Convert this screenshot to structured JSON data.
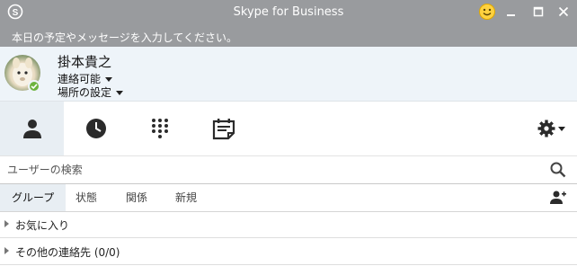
{
  "window": {
    "title": "Skype for Business",
    "icons": {
      "app": "skype-logo-icon",
      "emoji": "smiley-icon",
      "minimize": "minimize-icon",
      "maximize": "maximize-icon",
      "close": "close-icon"
    }
  },
  "note": {
    "placeholder": "本日の予定やメッセージを入力してください。"
  },
  "profile": {
    "name": "掛本貴之",
    "status": "連絡可能",
    "location": "場所の設定",
    "status_color": "#6cb33e"
  },
  "toolbar": {
    "tabs": [
      {
        "icon": "contacts-icon",
        "active": true
      },
      {
        "icon": "history-icon",
        "active": false
      },
      {
        "icon": "dialpad-icon",
        "active": false
      },
      {
        "icon": "meetings-icon",
        "active": false
      }
    ],
    "settings_icon": "gear-icon"
  },
  "search": {
    "placeholder": "ユーザーの検索"
  },
  "subtabs": [
    "グループ",
    "状態",
    "関係",
    "新規"
  ],
  "groups": [
    {
      "label": "お気に入り"
    },
    {
      "label": "その他の連絡先 (0/0)"
    }
  ],
  "colors": {
    "titlebar": "#999b9e",
    "profile_bg": "#eef4f9",
    "active_tab": "#e8eef3"
  }
}
